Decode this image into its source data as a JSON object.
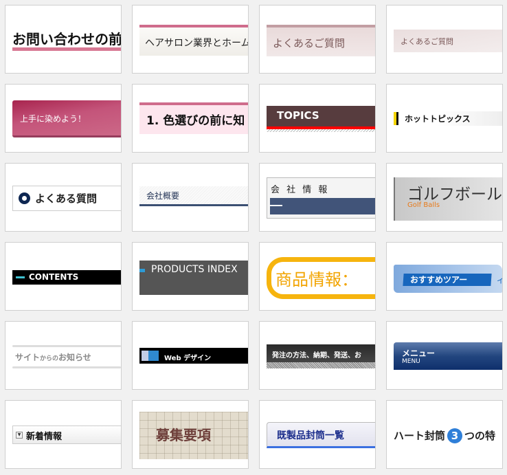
{
  "samples": [
    {
      "text": "お問い合わせの前に"
    },
    {
      "text": "ヘアサロン業界とホーム"
    },
    {
      "text": "よくあるご質問"
    },
    {
      "text": "よくあるご質問"
    },
    {
      "text": "上手に染めよう！"
    },
    {
      "text": "1.  色選びの前に知"
    },
    {
      "text": "TOPICS"
    },
    {
      "text": "ホットトピックス"
    },
    {
      "text": "よくある質問"
    },
    {
      "text": "会社概要"
    },
    {
      "text": "会 社 情 報"
    },
    {
      "text": "ゴルフボール",
      "sub": "Golf Balls"
    },
    {
      "text": "CONTENTS"
    },
    {
      "text": "PRODUCTS INDEX"
    },
    {
      "text": "商品情報："
    },
    {
      "text": "おすすめツアー",
      "extra": "イ"
    },
    {
      "text_a": "サイト",
      "text_b": "からの",
      "text_c": "お知らせ"
    },
    {
      "text": "Web デザイン"
    },
    {
      "text": "発注の方法、納期、発送、お"
    },
    {
      "text": "メニュー",
      "sub": "MENU"
    },
    {
      "text": "新着情報",
      "icon": "dropdown-arrow-icon"
    },
    {
      "text": "募集要項"
    },
    {
      "text": "既製品封筒一覧"
    },
    {
      "text_a": "ハート封筒",
      "num": "3",
      "text_b": "つの特"
    }
  ],
  "colors": {
    "pink": "#d06a8a",
    "navy": "#15305a",
    "red": "#ff0000",
    "orange": "#f6b40e",
    "blue": "#1a63b4"
  }
}
